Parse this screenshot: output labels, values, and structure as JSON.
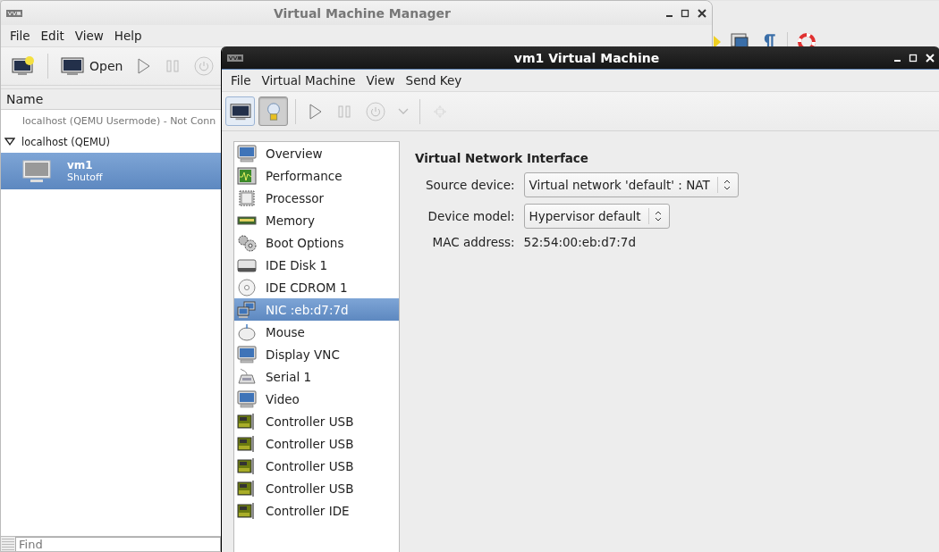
{
  "manager_window": {
    "title": "Virtual Machine Manager",
    "menu": [
      "File",
      "Edit",
      "View",
      "Help"
    ],
    "toolbar": [
      {
        "kind": "new"
      },
      {
        "kind": "open",
        "label": "Open"
      },
      {
        "kind": "play",
        "disabled": false
      },
      {
        "kind": "pause",
        "disabled": true
      },
      {
        "kind": "power",
        "disabled": true
      }
    ],
    "column_header": "Name",
    "connections": [
      {
        "name": "localhost (QEMU Usermode) - Not Conn",
        "connected": false
      },
      {
        "name": "localhost (QEMU)",
        "connected": true,
        "expanded": true,
        "vms": [
          {
            "name": "vm1",
            "status": "Shutoff",
            "selected": true
          }
        ]
      }
    ],
    "find": {
      "placeholder": "Find"
    }
  },
  "vm_window": {
    "title": "vm1 Virtual Machine",
    "menu": [
      "File",
      "Virtual Machine",
      "View",
      "Send Key"
    ],
    "toolbar": [
      {
        "kind": "console",
        "selected": false
      },
      {
        "kind": "details",
        "selected": true
      },
      {
        "kind": "sep"
      },
      {
        "kind": "play",
        "disabled": false
      },
      {
        "kind": "pause",
        "disabled": true
      },
      {
        "kind": "power",
        "disabled": true
      },
      {
        "kind": "caret",
        "disabled": true
      },
      {
        "kind": "sep"
      },
      {
        "kind": "fullscreen",
        "disabled": true
      }
    ],
    "hardware": [
      {
        "kind": "monitor",
        "label": "Overview",
        "selected": false
      },
      {
        "kind": "chart",
        "label": "Performance",
        "selected": false
      },
      {
        "kind": "chip",
        "label": "Processor",
        "selected": false
      },
      {
        "kind": "ram",
        "label": "Memory",
        "selected": false
      },
      {
        "kind": "gears",
        "label": "Boot Options",
        "selected": false
      },
      {
        "kind": "disk",
        "label": "IDE Disk 1",
        "selected": false
      },
      {
        "kind": "cdrom",
        "label": "IDE CDROM 1",
        "selected": false
      },
      {
        "kind": "network",
        "label": "NIC :eb:d7:7d",
        "selected": true
      },
      {
        "kind": "mouse",
        "label": "Mouse",
        "selected": false
      },
      {
        "kind": "monitor",
        "label": "Display VNC",
        "selected": false
      },
      {
        "kind": "serial",
        "label": "Serial 1",
        "selected": false
      },
      {
        "kind": "monitor",
        "label": "Video",
        "selected": false
      },
      {
        "kind": "card",
        "label": "Controller USB",
        "selected": false
      },
      {
        "kind": "card",
        "label": "Controller USB",
        "selected": false
      },
      {
        "kind": "card",
        "label": "Controller USB",
        "selected": false
      },
      {
        "kind": "card",
        "label": "Controller USB",
        "selected": false
      },
      {
        "kind": "card",
        "label": "Controller IDE",
        "selected": false
      }
    ],
    "details": {
      "heading": "Virtual Network Interface",
      "fields": [
        {
          "kind": "combo",
          "label": "Source device:",
          "value": "Virtual network 'default' : NAT"
        },
        {
          "kind": "combo",
          "label": "Device model:",
          "value": "Hypervisor default"
        },
        {
          "kind": "text",
          "label": "MAC address:",
          "value": "52:54:00:eb:d7:7d"
        }
      ]
    }
  }
}
